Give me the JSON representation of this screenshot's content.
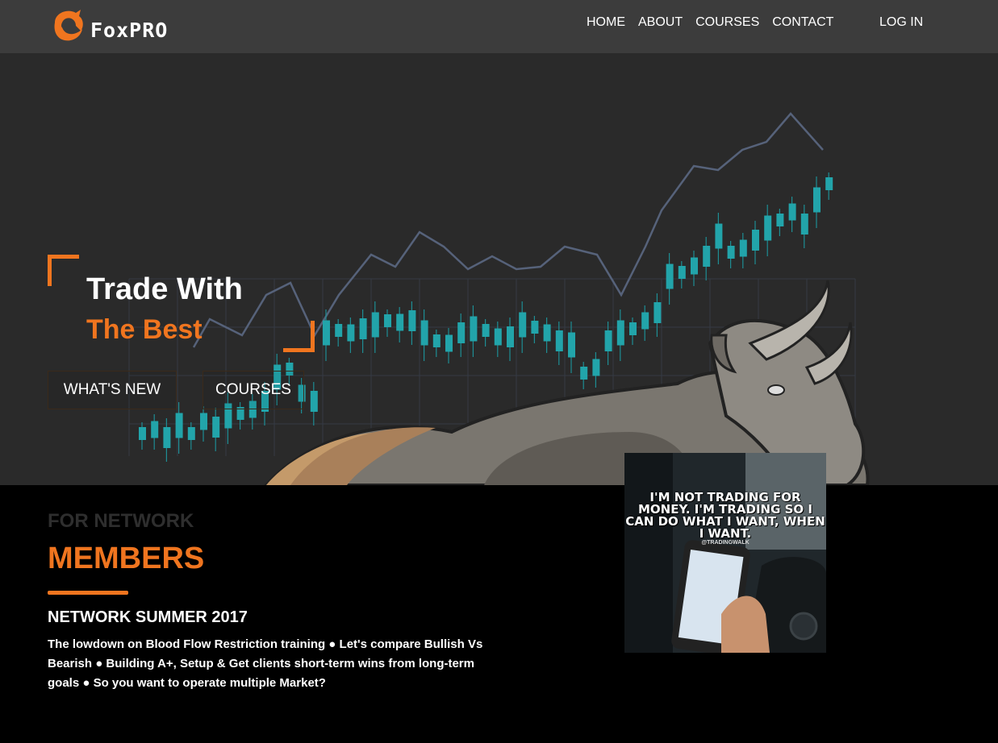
{
  "brand": {
    "name": "FoxPRO",
    "accent": "#f0751f"
  },
  "nav": {
    "links": [
      "HOME",
      "ABOUT",
      "COURSES",
      "CONTACT"
    ],
    "login": "LOG IN"
  },
  "hero": {
    "title": "Trade With",
    "subtitle": "The Best",
    "buttons": [
      "WHAT'S NEW",
      "COURSES"
    ]
  },
  "members": {
    "pre_title": "FOR NETWORK",
    "title": "MEMBERS",
    "heading": "NETWORK SUMMER 2017",
    "body": "The lowdown on Blood Flow Restriction training ● Let's compare Bullish Vs Bearish ● Building A+, Setup & Get clients short-term wins from long-term goals ● So you want to operate multiple Market?"
  },
  "photo": {
    "quote": "I'M NOT TRADING FOR MONEY. I'M TRADING SO I CAN DO WHAT I WANT, WHEN I WANT.",
    "tag": "@TRADINGWALK"
  },
  "icons": {
    "logo": "fox-logo-icon"
  }
}
